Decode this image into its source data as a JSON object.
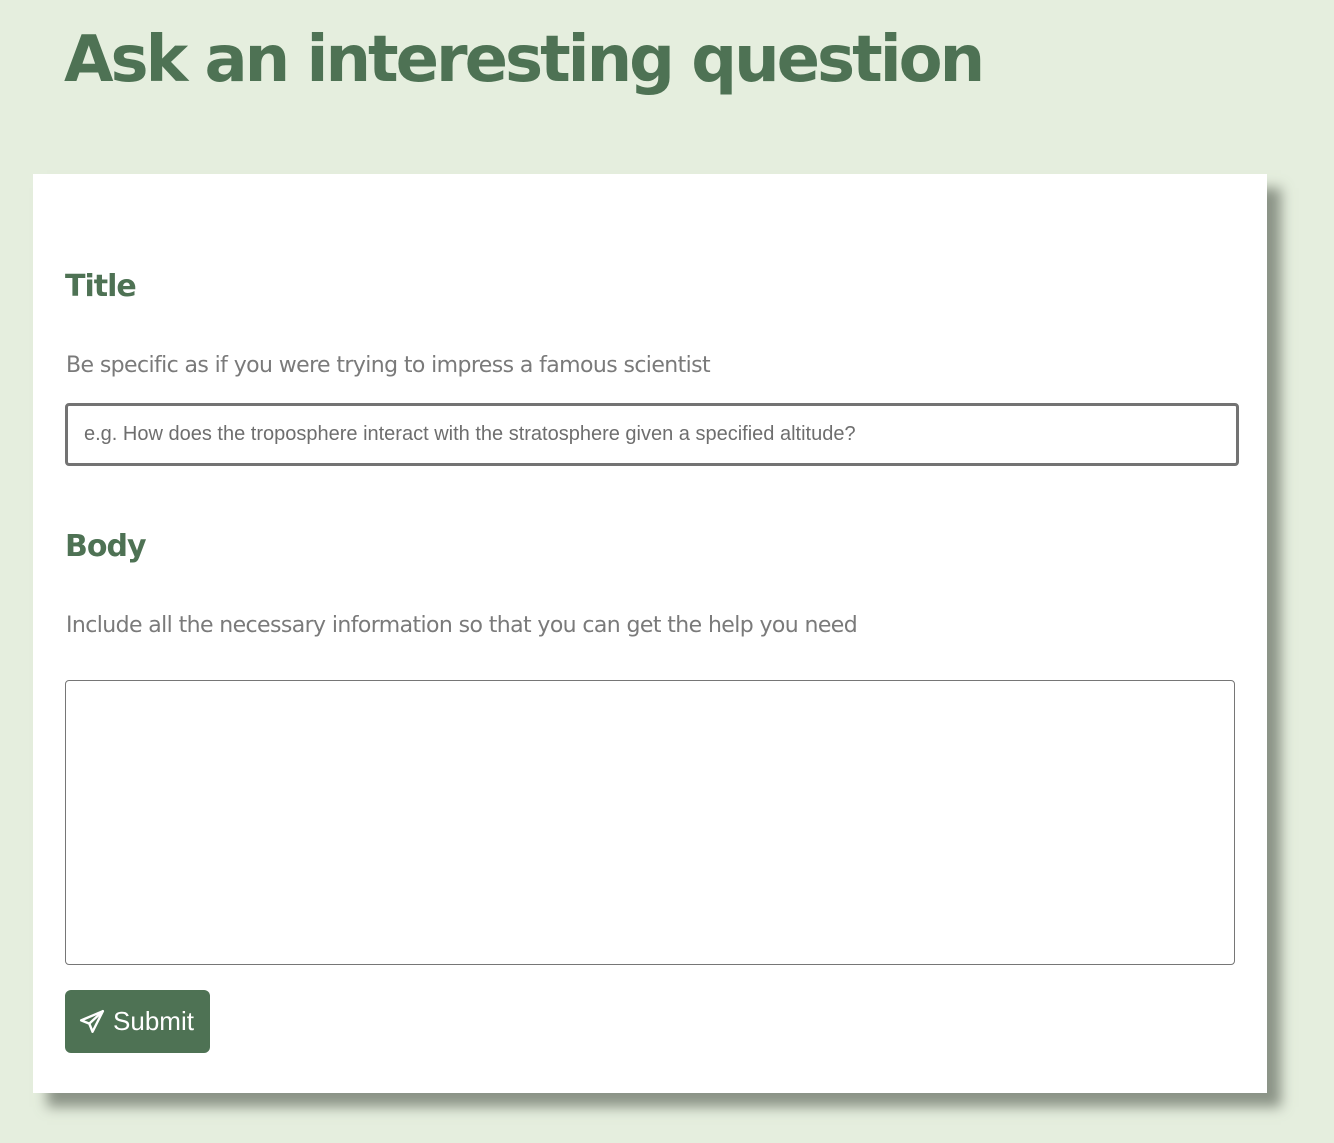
{
  "page": {
    "title": "Ask an interesting question"
  },
  "form": {
    "title_section": {
      "label": "Title",
      "hint": "Be specific as if you were trying to impress a famous scientist",
      "value": "",
      "placeholder": "e.g. How does the troposphere interact with the stratosphere given a specified altitude?"
    },
    "body_section": {
      "label": "Body",
      "hint": "Include all the necessary information so that you can get the help you need",
      "value": ""
    },
    "submit": {
      "label": "Submit",
      "icon": "paper-plane-icon"
    }
  },
  "colors": {
    "background": "#e5eede",
    "accent": "#4e7254",
    "hint_text": "#7a7a7a",
    "card": "#ffffff"
  }
}
